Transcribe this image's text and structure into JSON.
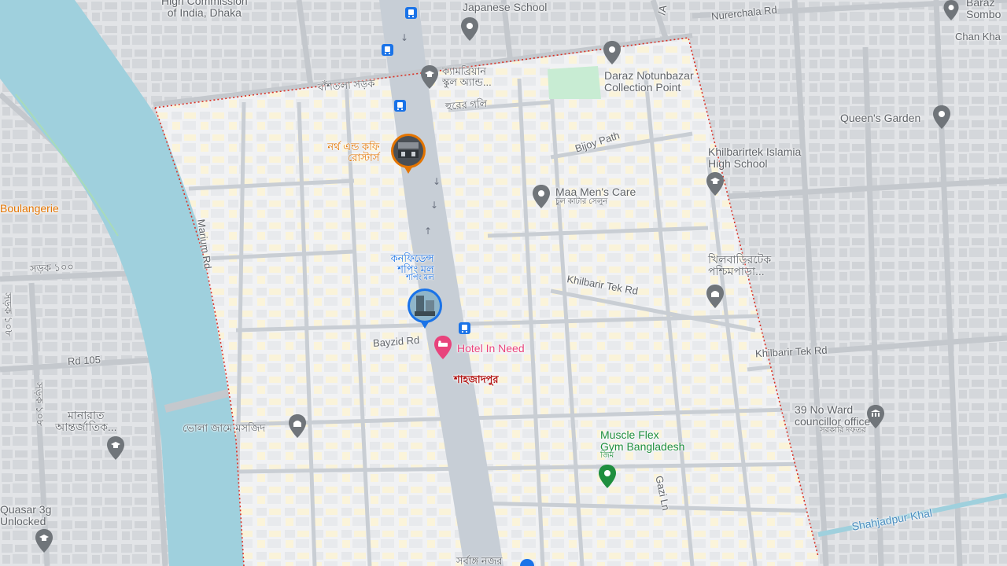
{
  "colors": {
    "river": "#9fd0dd",
    "boundary": "#d93025",
    "park": "#c8ecd3",
    "poi_gray": "#70757a",
    "poi_green": "#1e8e3e",
    "poi_orange": "#e37400",
    "poi_blue": "#1a73e8",
    "poi_pink": "#e8437c",
    "area_label": "#b31412"
  },
  "labels": {
    "high_commission_l1": "High Commission",
    "high_commission_l2": "of India, Dhaka",
    "japanese_school": "Japanese School",
    "nurerchala_rd": "Nurerchala Rd",
    "road_a": "/A",
    "baridhara_l1": "Baraz",
    "baridhara_l2": "Sombo",
    "chan_kha": "Chan Kha",
    "cambrian_l1": "ক্যামব্রিয়ান",
    "cambrian_l2": "স্কুল অ্যান্ড...",
    "bashtola_sarak": "বাঁশতলা সড়ক",
    "hurer_goli": "হুরের গলি",
    "daraz_l1": "Daraz Notunbazar",
    "daraz_l2": "Collection Point",
    "queens_garden": "Queen's Garden",
    "north_end_l1": "নর্থ এন্ড কফি",
    "north_end_l2": "রোস্টার্স",
    "bijoy_path": "Bijoy Path",
    "khilbarirtek_l1": "Khilbarirtek Islamia",
    "khilbarirtek_l2": "High School",
    "boulangerie": "Boulangerie",
    "marium_rd": "Marium Rd",
    "maa_mens_care": "Maa Men's Care",
    "maa_mens_sub": "চুল কাটার সেলুন",
    "sarak_100": "সড়ক ১০০",
    "confidence_l1": "কনফিডেন্স",
    "confidence_l2": "শপিং মল",
    "confidence_sub": "শপিং মল",
    "khilbarir_bn_l1": "খিলবাড়িরটেক",
    "khilbarir_bn_l2": "পশ্চিমপাড়া...",
    "khilbarir_tek_rd": "Khilbarir Tek Rd",
    "khilbarir_tek_rd2": "Khilbarir Tek Rd",
    "sarak_108": "সড়ক ১০৮",
    "bayzid_rd": "Bayzid Rd",
    "hotel_in_need": "Hotel In Need",
    "rd_105": "Rd 105",
    "shahjadpur": "শাহজাদপুর",
    "sarak_108b": "সড়ক ১০৮",
    "ward_office_l1": "39 No Ward",
    "ward_office_l2": "councillor office",
    "ward_office_sub": "সরকারি দফতর",
    "manarat_l1": "মানারাত",
    "manarat_l2": "আন্তর্জাতিক...",
    "bhola_mosque": "ভোলা জামে মসজিদ",
    "muscle_flex_l1": "Muscle Flex",
    "muscle_flex_l2": "Gym Bangladesh",
    "muscle_flex_sub": "জিম",
    "gazi_ln": "Gazi Ln",
    "quasar_l1": "Quasar 3g",
    "quasar_l2": "Unlocked",
    "shahjadpur_khal": "Shahjadpur Khal",
    "sarbanga_bottom": "সর্বাঙ্গ নজর"
  },
  "icons": {
    "bus": "bus-stop-icon",
    "pin": "place-pin-icon",
    "school": "school-icon",
    "mosque": "mosque-icon",
    "gym": "gym-icon",
    "hotel": "hotel-icon",
    "government": "government-building-icon"
  }
}
